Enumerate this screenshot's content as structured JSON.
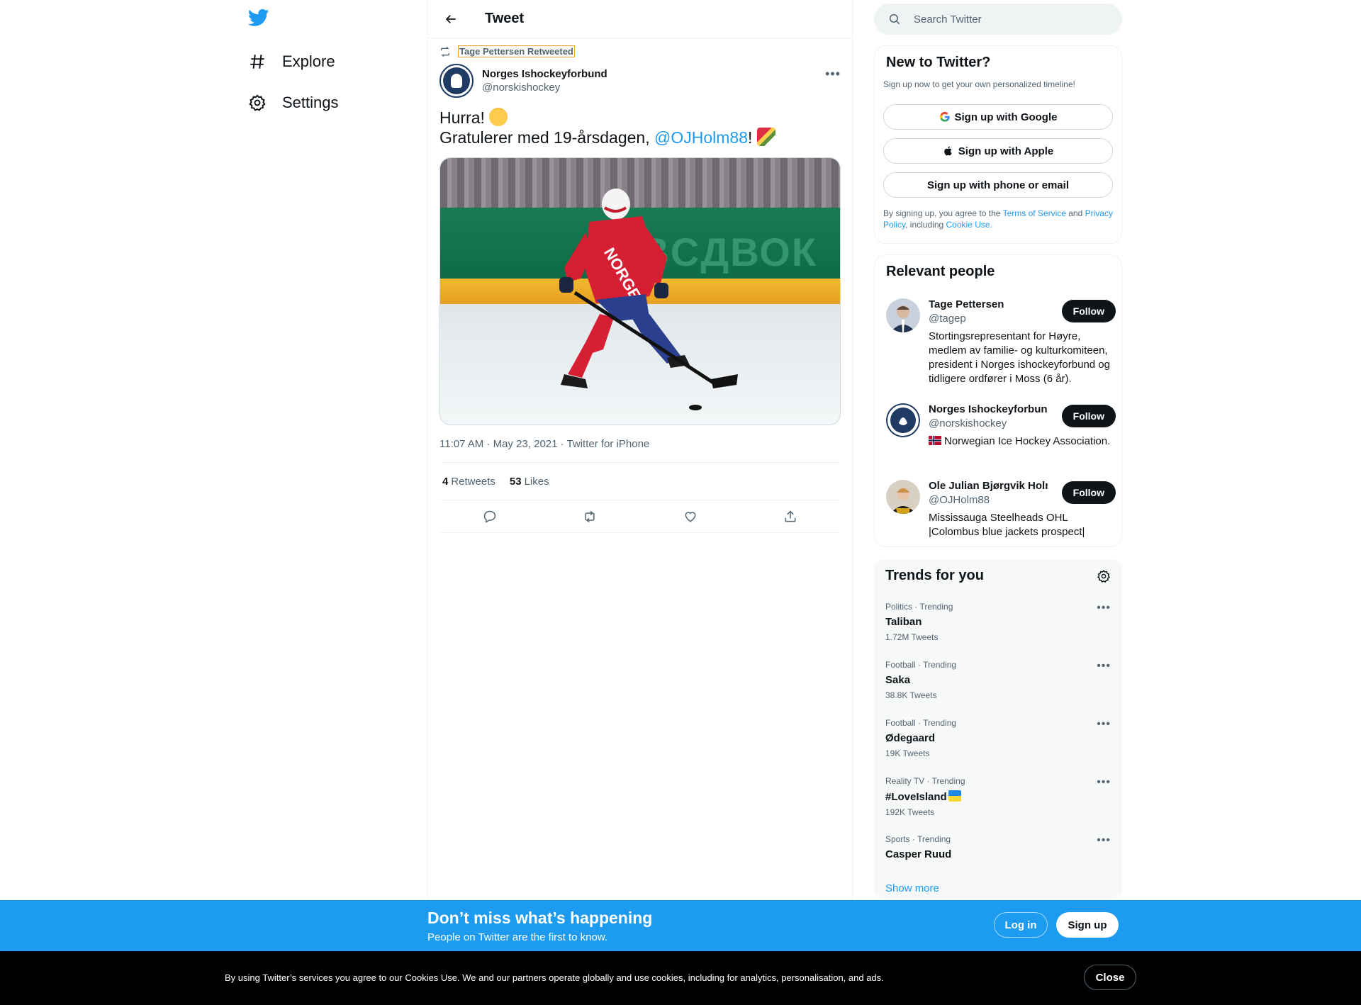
{
  "nav": {
    "explore_label": "Explore",
    "settings_label": "Settings"
  },
  "header": {
    "title": "Tweet"
  },
  "tweet": {
    "retweet_label": "Tage Pettersen Retweeted",
    "author_name": "Norges Ishockeyforbund",
    "author_handle": "@norskishockey",
    "line1": "Hurra! ",
    "line2_prefix": "Gratulerer med 19-årsdagen, ",
    "mention": "@OJHolm88",
    "line2_suffix": "! ",
    "photo_ad_text": "ABCДВОК",
    "photo_jersey_text": "NORGE",
    "timestamp": "11:07 AM · May 23, 2021 · Twitter for iPhone",
    "retweets_count": "4",
    "retweets_label": "Retweets",
    "likes_count": "53",
    "likes_label": "Likes"
  },
  "search": {
    "placeholder": "Search Twitter"
  },
  "new_to_twitter": {
    "title": "New to Twitter?",
    "subtitle": "Sign up now to get your own personalized timeline!",
    "google": "Sign up with Google",
    "apple": "Sign up with Apple",
    "phone": "Sign up with phone or email",
    "terms_prefix": "By signing up, you agree to the ",
    "terms_link": "Terms of Service",
    "terms_and": " and ",
    "privacy_link": "Privacy Policy",
    "terms_including": ", including ",
    "cookie_link": "Cookie Use."
  },
  "relevant_people": {
    "title": "Relevant people",
    "people": [
      {
        "name": "Tage Pettersen",
        "handle": "@tagep",
        "bio": "Stortingsrepresentant for Høyre, medlem av familie- og kulturkomiteen, president i Norges ishockeyforbund og tidligere ordfører i Moss (6 år).",
        "follow": "Follow"
      },
      {
        "name": "Norges Ishockeyforbund",
        "handle": "@norskishockey",
        "bio": "Norwegian Ice Hockey Association.",
        "follow": "Follow"
      },
      {
        "name": "Ole Julian Bjørgvik Holm",
        "handle": "@OJHolm88",
        "bio": "Mississauga Steelheads OHL |Colombus blue jackets prospect|",
        "follow": "Follow"
      }
    ]
  },
  "trends": {
    "title": "Trends for you",
    "items": [
      {
        "category": "Politics · Trending",
        "name": "Taliban",
        "count": "1.72M Tweets"
      },
      {
        "category": "Football · Trending",
        "name": "Saka",
        "count": "38.8K Tweets"
      },
      {
        "category": "Football · Trending",
        "name": "Ødegaard",
        "count": "19K Tweets"
      },
      {
        "category": "Reality TV · Trending",
        "name": "#LoveIsland",
        "count": "192K Tweets"
      },
      {
        "category": "Sports · Trending",
        "name": "Casper Ruud",
        "count": ""
      }
    ],
    "show_more": "Show more"
  },
  "banner": {
    "title": "Don’t miss what’s happening",
    "subtitle": "People on Twitter are the first to know.",
    "login": "Log in",
    "signup": "Sign up"
  },
  "cookie": {
    "text": "By using Twitter’s services you agree to our Cookies Use. We and our partners operate globally and use cookies, including for analytics, personalisation, and ads.",
    "close": "Close"
  },
  "colors": {
    "accent": "#1d9bf0",
    "text": "#0f1419",
    "secondary": "#536471"
  }
}
